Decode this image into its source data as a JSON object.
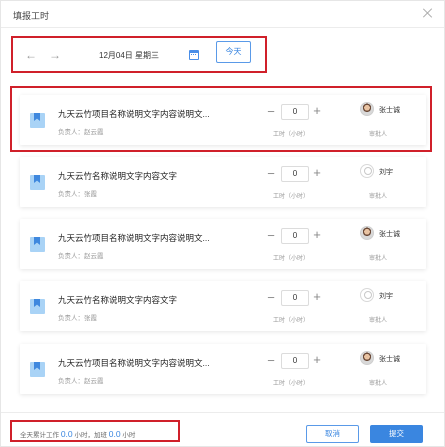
{
  "dialog": {
    "title": "填报工时"
  },
  "toolbar": {
    "prev_icon": "arrow-left-icon",
    "next_icon": "arrow-right-icon",
    "prev_glyph": "←",
    "next_glyph": "→",
    "date": "12月04日  星期三",
    "calendar_icon": "calendar-icon",
    "today_label": "今天"
  },
  "tasks": [
    {
      "name": "九天云竹项目名称说明文字内容说明文...",
      "owner": "负责人：赵云霞",
      "hours": "0",
      "hours_label": "工时（小时）",
      "approver": "张士诚",
      "approver_label": "审批人",
      "minus": "−",
      "plus": "+"
    },
    {
      "name": "九天云竹名称说明文字内容文字",
      "owner": "负责人：张霞",
      "hours": "0",
      "hours_label": "工时（小时）",
      "approver": "刘宇",
      "approver_label": "审批人",
      "minus": "−",
      "plus": "+"
    },
    {
      "name": "九天云竹项目名称说明文字内容说明文...",
      "owner": "负责人：赵云霞",
      "hours": "0",
      "hours_label": "工时（小时）",
      "approver": "张士诚",
      "approver_label": "审批人",
      "minus": "−",
      "plus": "+"
    },
    {
      "name": "九天云竹名称说明文字内容文字",
      "owner": "负责人：张霞",
      "hours": "0",
      "hours_label": "工时（小时）",
      "approver": "刘宇",
      "approver_label": "审批人",
      "minus": "−",
      "plus": "+"
    },
    {
      "name": "九天云竹项目名称说明文字内容说明文...",
      "owner": "负责人：赵云霞",
      "hours": "0",
      "hours_label": "工时（小时）",
      "approver": "张士诚",
      "approver_label": "审批人",
      "minus": "−",
      "plus": "+"
    }
  ],
  "footer": {
    "total_prefix": "全天累计工作",
    "total_hours": "0.0",
    "unit1": "小时，加班",
    "overtime_hours": "0.0",
    "unit2": "小时",
    "cancel_label": "取消",
    "submit_label": "提交"
  },
  "colors": {
    "accent": "#3a86e0",
    "highlight": "#d0202a"
  }
}
